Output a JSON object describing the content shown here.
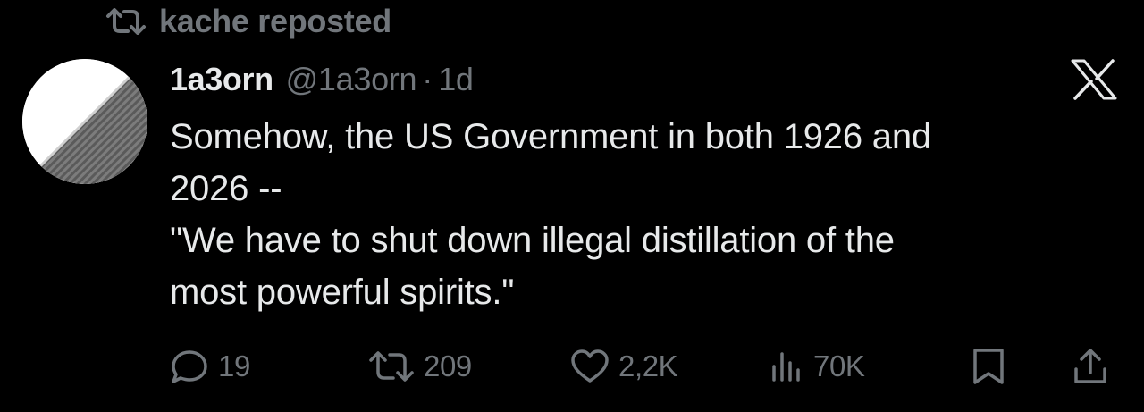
{
  "repost": {
    "icon": "repost-icon",
    "label": "kache reposted"
  },
  "tweet": {
    "author": {
      "avatar": "avatar",
      "display_name": "1a3orn",
      "handle": "@1a3orn",
      "separator": "·",
      "time": "1d"
    },
    "brand_icon": "x-logo-icon",
    "lines": [
      "Somehow, the US Government in both 1926 and",
      "2026 --",
      "\"We have to shut down illegal distillation of the",
      "most powerful spirits.\""
    ],
    "actions": {
      "replies": {
        "icon": "reply-icon",
        "count": "19"
      },
      "reposts": {
        "icon": "repost-icon",
        "count": "209"
      },
      "likes": {
        "icon": "like-icon",
        "count": "2,2K"
      },
      "views": {
        "icon": "views-icon",
        "count": "70K"
      },
      "bookmark": {
        "icon": "bookmark-icon"
      },
      "share": {
        "icon": "share-icon"
      }
    }
  },
  "colors": {
    "background": "#000000",
    "text": "#e7e9ea",
    "muted": "#71767b"
  }
}
